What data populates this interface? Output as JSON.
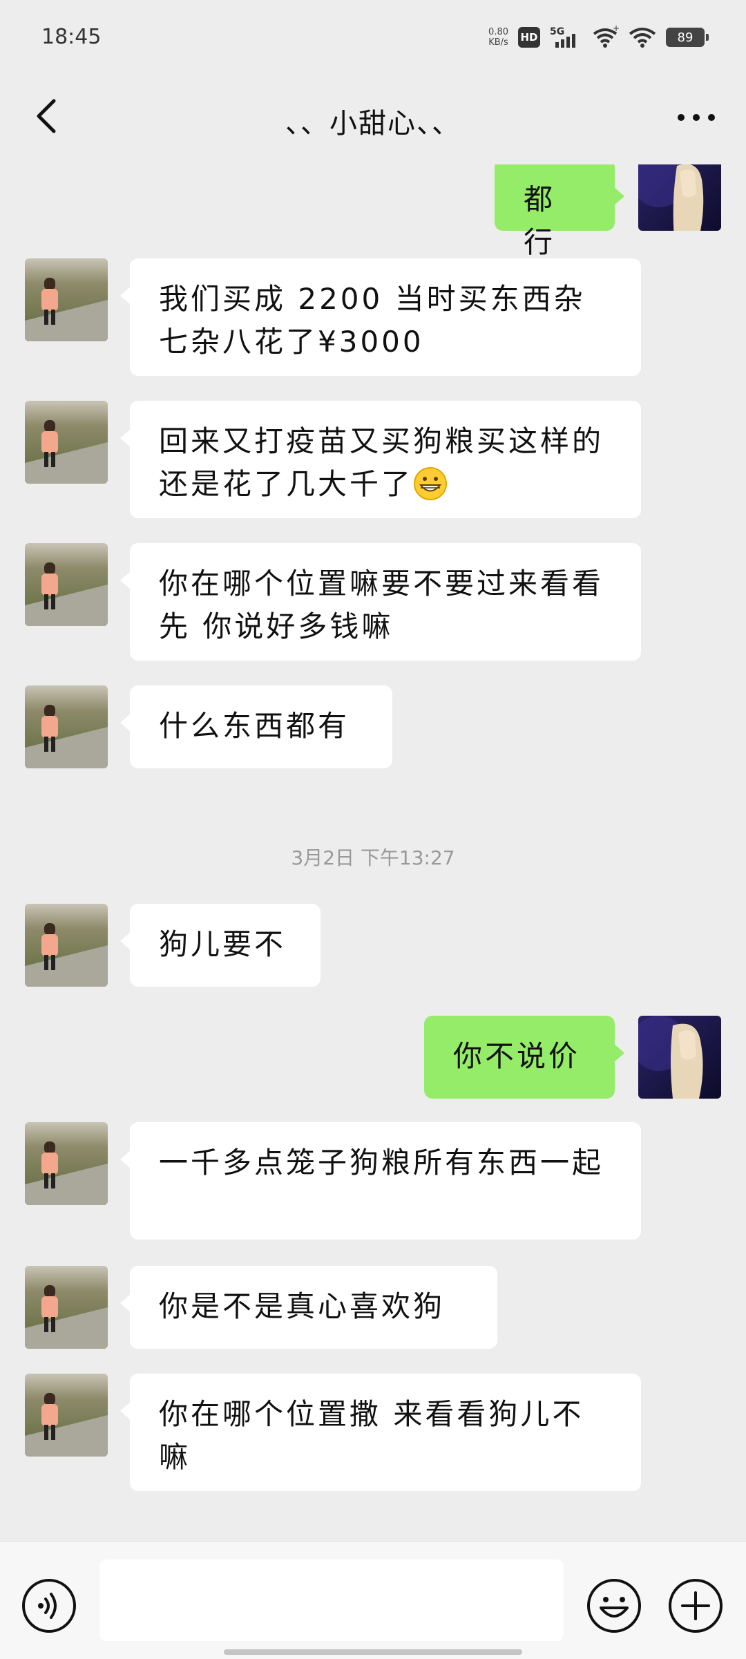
{
  "status_bar": {
    "time": "18:45",
    "net_speed_value": "0.80",
    "net_speed_unit": "KB/s",
    "hd_label": "HD",
    "signal_label": "5G",
    "battery": "89"
  },
  "header": {
    "title": "、、小甜心、、",
    "back_icon": "chevron-left-icon",
    "more_icon": "more-horizontal-icon"
  },
  "messages": [
    {
      "side": "right",
      "text": "都行"
    },
    {
      "side": "left",
      "text": "我们买成 2200 当时买东西杂七杂八花了¥3000"
    },
    {
      "side": "left",
      "text": "回来又打疫苗又买狗粮买这样的还是花了几大千了",
      "emoji": "grinning-face-icon"
    },
    {
      "side": "left",
      "text": "你在哪个位置嘛要不要过来看看先 你说好多钱嘛"
    },
    {
      "side": "left",
      "text": "什么东西都有"
    },
    {
      "type": "timestamp",
      "text": "3月2日 下午13:27"
    },
    {
      "side": "left",
      "text": "狗儿要不"
    },
    {
      "side": "right",
      "text": "你不说价"
    },
    {
      "side": "left",
      "text": "一千多点笼子狗粮所有东西一起"
    },
    {
      "side": "left",
      "text": "你是不是真心喜欢狗"
    },
    {
      "side": "left",
      "text": "你在哪个位置撒 来看看狗儿不嘛"
    }
  ],
  "input_bar": {
    "voice_icon": "voice-icon",
    "input_value": "",
    "emoji_icon": "emoji-icon",
    "plus_icon": "plus-icon"
  },
  "colors": {
    "background": "#ededed",
    "sent_bubble": "#95ec69",
    "received_bubble": "#ffffff",
    "timestamp_text": "#999999"
  }
}
